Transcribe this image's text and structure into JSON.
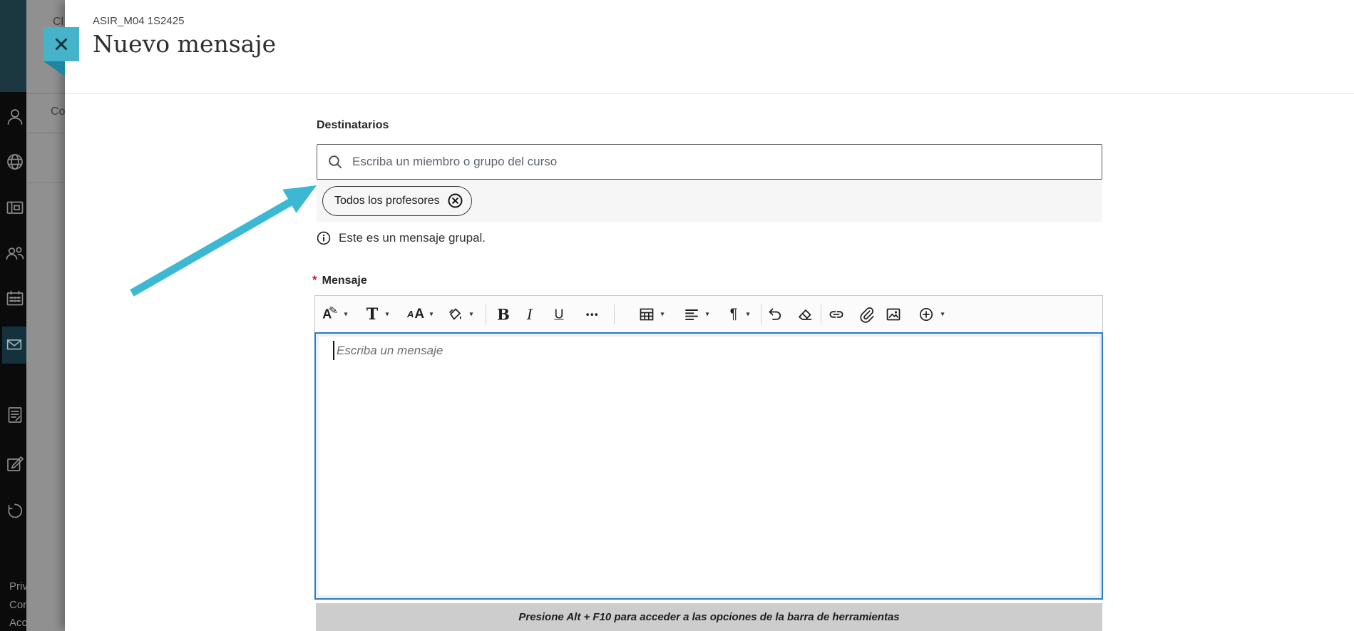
{
  "colors": {
    "accent_teal": "#45b3c9",
    "fold_teal": "#1e86a0",
    "arrow_cyan": "#3db8d2",
    "focus_blue": "#2e7bc0",
    "required_red": "#d40f2f",
    "sidebar_bg": "#0b0b0b",
    "sidebar_top_bg": "#1b3840",
    "active_tile_bg": "#15323c"
  },
  "panel": {
    "course_code": "ASIR_M04 1S2425",
    "title": "Nuevo mensaje"
  },
  "recipients": {
    "label": "Destinatarios",
    "search_placeholder": "Escriba un miembro o grupo del curso",
    "chips": [
      {
        "label": "Todos los profesores"
      }
    ],
    "info_note": "Este es un mensaje grupal."
  },
  "message": {
    "required_marker": "*",
    "label": "Mensaje",
    "editor_placeholder": "Escriba un mensaje",
    "toolbar_hint": "Presione Alt + F10 para acceder a las opciones de la barra de herramientas"
  },
  "toolbar_glyphs": {
    "style_letter": "A",
    "style_pencil": "✎",
    "heading": "T",
    "font_small": "A",
    "font_large": "A",
    "bold": "B",
    "italic": "I",
    "underline": "U",
    "more": "•••",
    "paragraph": "¶",
    "caret": "▾"
  },
  "sidebar": {
    "items": [
      "profile",
      "globe",
      "institution",
      "groups",
      "calendar",
      "messages",
      "grades",
      "activity",
      "sign-out"
    ],
    "active_item": "messages",
    "footer_fragments": [
      "Priv",
      "Con",
      "Acc"
    ]
  },
  "background_page": {
    "heading_fragment": "Cl",
    "tab_fragment": "Co"
  }
}
